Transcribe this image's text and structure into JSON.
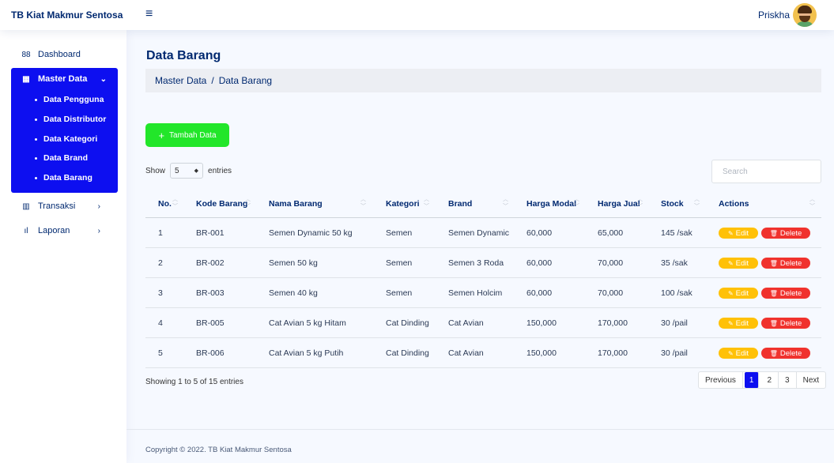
{
  "app": {
    "brand": "TB Kiat Makmur Sentosa",
    "menu_icon": "≡",
    "user": "Priskha"
  },
  "sidebar": {
    "dashboard": {
      "icon": "88",
      "label": "Dashboard"
    },
    "master": {
      "icon": "▦",
      "label": "Master Data",
      "chevron": "⌄",
      "items": [
        "Data Pengguna",
        "Data Distributor",
        "Data Kategori",
        "Data Brand",
        "Data Barang"
      ]
    },
    "transaksi": {
      "icon": "▥",
      "label": "Transaksi",
      "chevron": "›"
    },
    "laporan": {
      "icon": "ıl",
      "label": "Laporan",
      "chevron": "›"
    }
  },
  "page": {
    "title": "Data Barang",
    "breadcrumb": [
      "Master Data",
      "Data Barang"
    ],
    "breadcrumb_sep": "/",
    "add_button": {
      "icon": "+",
      "label": "Tambah Data"
    },
    "show_label": "Show",
    "entries_value": "5",
    "entries_label": "entries",
    "search_placeholder": "Search"
  },
  "table": {
    "columns": [
      "No.",
      "Kode Barang",
      "Nama Barang",
      "Kategori",
      "Brand",
      "Harga Modal",
      "Harga Jual",
      "Stock",
      "Actions"
    ],
    "sort_icons": {
      "up": "︿",
      "down": "﹀"
    },
    "edit_label": "Edit",
    "edit_icon": "✎",
    "delete_label": "Delete",
    "delete_icon": "🗑",
    "rows": [
      {
        "no": "1",
        "kode": "BR-001",
        "nama": "Semen Dynamic 50 kg",
        "kategori": "Semen",
        "brand": "Semen Dynamic",
        "modal": "60,000",
        "jual": "65,000",
        "stock": "145 /sak"
      },
      {
        "no": "2",
        "kode": "BR-002",
        "nama": "Semen 50 kg",
        "kategori": "Semen",
        "brand": "Semen 3 Roda",
        "modal": "60,000",
        "jual": "70,000",
        "stock": "35 /sak"
      },
      {
        "no": "3",
        "kode": "BR-003",
        "nama": "Semen 40 kg",
        "kategori": "Semen",
        "brand": "Semen Holcim",
        "modal": "60,000",
        "jual": "70,000",
        "stock": "100 /sak"
      },
      {
        "no": "4",
        "kode": "BR-005",
        "nama": "Cat Avian 5 kg Hitam",
        "kategori": "Cat Dinding",
        "brand": "Cat Avian",
        "modal": "150,000",
        "jual": "170,000",
        "stock": "30 /pail"
      },
      {
        "no": "5",
        "kode": "BR-006",
        "nama": "Cat Avian 5 kg Putih",
        "kategori": "Cat Dinding",
        "brand": "Cat Avian",
        "modal": "150,000",
        "jual": "170,000",
        "stock": "30 /pail"
      }
    ]
  },
  "pagination": {
    "showing": "Showing 1 to 5 of 15 entries",
    "previous": "Previous",
    "pages": [
      "1",
      "2",
      "3"
    ],
    "active_page": "1",
    "next": "Next"
  },
  "footer": {
    "copyright": "Copyright © 2022. TB Kiat Makmur Sentosa"
  },
  "colors": {
    "primary": "#0d0ff0",
    "add": "#22e62a",
    "edit": "#ffc107",
    "delete": "#f0322d",
    "text": "#012970"
  }
}
